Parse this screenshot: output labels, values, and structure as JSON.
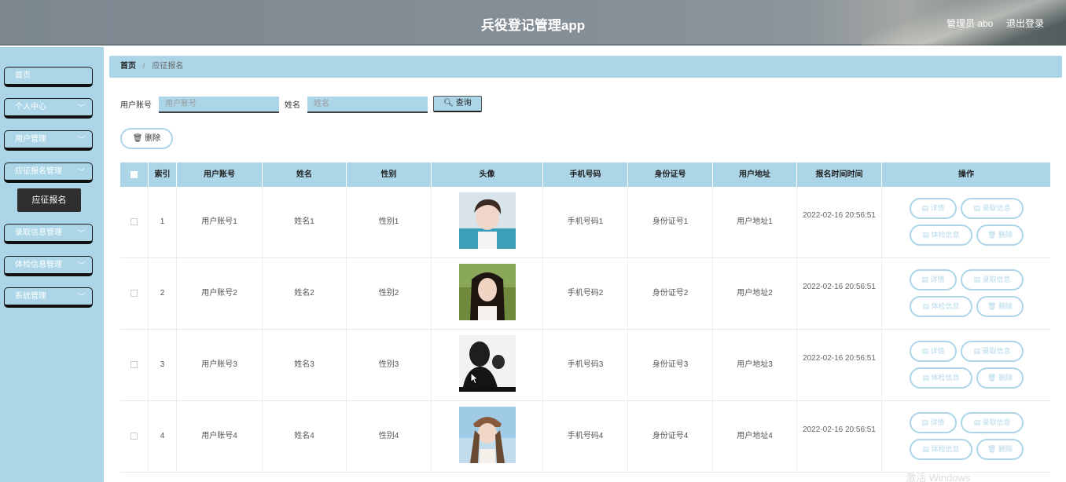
{
  "app": {
    "title": "兵役登记管理app",
    "admin_label": "管理员 abo",
    "logout_label": "退出登录"
  },
  "sidebar": {
    "items": [
      {
        "label": "首页",
        "has_chevron": false
      },
      {
        "label": "个人中心",
        "has_chevron": true
      },
      {
        "label": "用户管理",
        "has_chevron": true
      },
      {
        "label": "应征报名管理",
        "has_chevron": true
      },
      {
        "label": "录取信息管理",
        "has_chevron": true
      },
      {
        "label": "体检信息管理",
        "has_chevron": true
      },
      {
        "label": "系统管理",
        "has_chevron": true
      }
    ],
    "popup_label": "应征报名"
  },
  "breadcrumb": {
    "home": "首页",
    "current": "应征报名"
  },
  "search": {
    "account_label": "用户账号",
    "account_placeholder": "用户账号",
    "name_label": "姓名",
    "name_placeholder": "姓名",
    "query_label": "查询",
    "delete_label": "删除"
  },
  "table": {
    "headers": [
      "索引",
      "用户账号",
      "姓名",
      "性别",
      "头像",
      "手机号码",
      "身份证号",
      "用户地址",
      "报名时间时间",
      "操作"
    ],
    "rows": [
      {
        "index": "1",
        "account": "用户账号1",
        "name": "姓名1",
        "gender": "性别1",
        "phone": "手机号码1",
        "id_number": "身份证号1",
        "address": "用户地址1",
        "time": "2022-02-16 20:56:51"
      },
      {
        "index": "2",
        "account": "用户账号2",
        "name": "姓名2",
        "gender": "性别2",
        "phone": "手机号码2",
        "id_number": "身份证号2",
        "address": "用户地址2",
        "time": "2022-02-16 20:56:51"
      },
      {
        "index": "3",
        "account": "用户账号3",
        "name": "姓名3",
        "gender": "性别3",
        "phone": "手机号码3",
        "id_number": "身份证号3",
        "address": "用户地址3",
        "time": "2022-02-16 20:56:51"
      },
      {
        "index": "4",
        "account": "用户账号4",
        "name": "姓名4",
        "gender": "性别4",
        "phone": "手机号码4",
        "id_number": "身份证号4",
        "address": "用户地址4",
        "time": "2022-02-16 20:56:51"
      }
    ],
    "actions": {
      "detail": "详情",
      "admission": "录取信息",
      "exam": "体检信息",
      "delete": "删除"
    }
  },
  "watermark": "激活 Windows",
  "colors": {
    "accent": "#acd6e8",
    "header": "#858f97"
  }
}
